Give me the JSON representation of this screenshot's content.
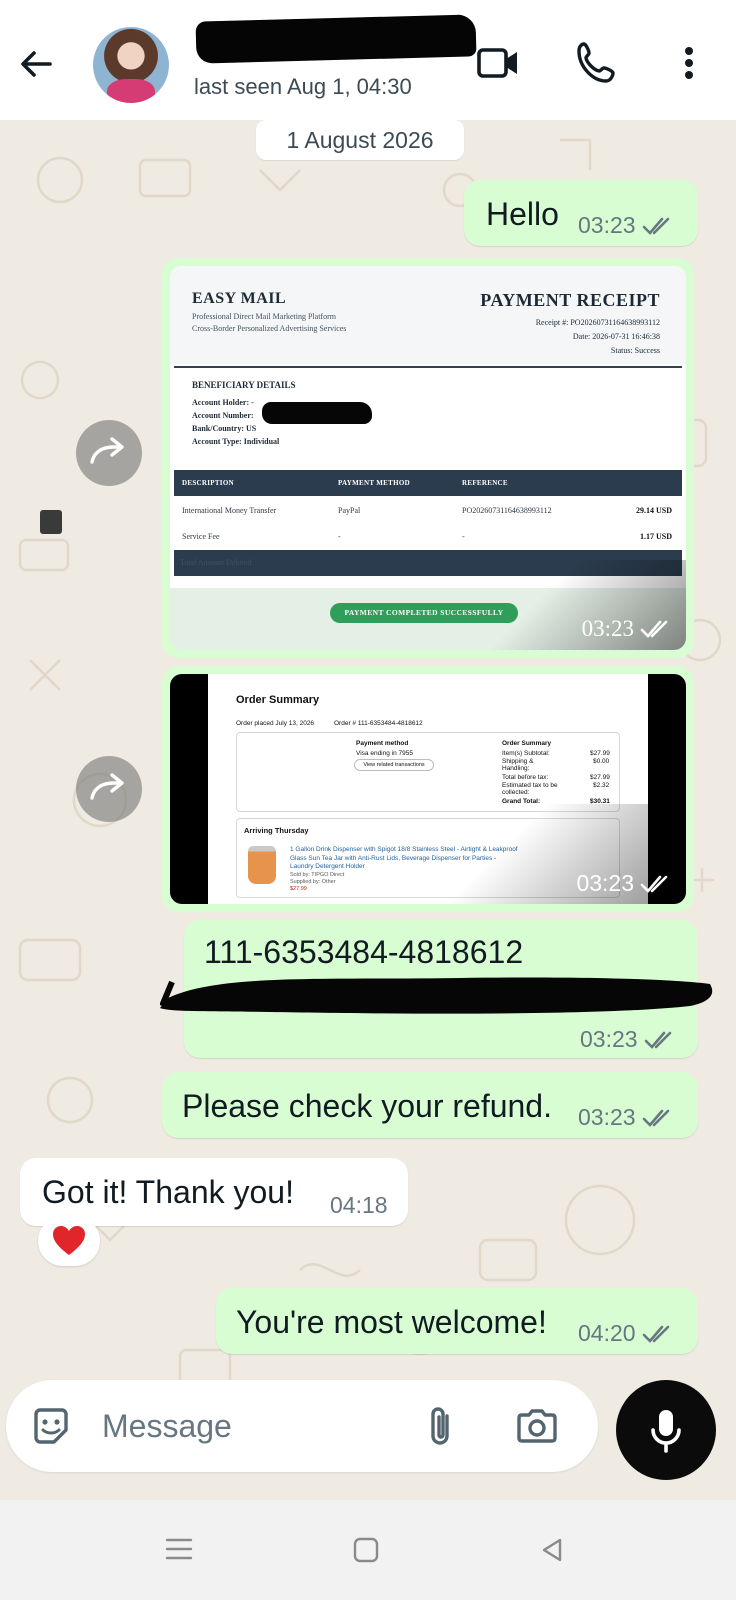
{
  "header": {
    "contact_name": "",
    "last_seen": "last seen Aug 1, 04:30",
    "video_call_icon": "video-call-icon",
    "voice_call_icon": "phone-icon",
    "menu_icon": "more-vert-icon"
  },
  "chat": {
    "date_chip": "1 August 2026",
    "messages": [
      {
        "text": "Hello",
        "time": "03:23"
      },
      {
        "time": "03:23"
      },
      {
        "time": "03:23"
      },
      {
        "text": "111-6353484-4818612",
        "time": "03:23"
      },
      {
        "text": "Please check your refund.",
        "time": "03:23"
      },
      {
        "text": "Got it! Thank you!",
        "time": "04:18",
        "reaction": "❤️"
      },
      {
        "text": "You're most welcome!",
        "time": "04:20"
      }
    ]
  },
  "receipt": {
    "brand": "EASY MAIL",
    "brand_sub1": "Professional Direct Mail Marketing Platform",
    "brand_sub2": "Cross-Border Personalized Advertising Services",
    "title": "PAYMENT RECEIPT",
    "receipt_no": "Receipt #: PO2026073116463899311​2",
    "date": "Date: 2026-07-31 16:46:38",
    "status": "Status: Success",
    "section": "BENEFICIARY DETAILS",
    "account_holder": "Account Holder: -",
    "account_number": "Account Number:",
    "bank_country": "Bank/Country: US",
    "account_type": "Account Type: Individual",
    "th_description": "DESCRIPTION",
    "th_method": "PAYMENT METHOD",
    "th_reference": "REFERENCE",
    "row1_desc": "International Money Transfer",
    "row1_method": "PayPal",
    "row1_ref": "PO2026073116463899311​2",
    "row1_amount": "29.14 USD",
    "row2_desc": "Service Fee",
    "row2_method": "-",
    "row2_ref": "-",
    "row2_amount": "1.17 USD",
    "total_label": "Total Amount Debited",
    "banner": "PAYMENT COMPLETED SUCCESSFULLY"
  },
  "order": {
    "title": "Order Summary",
    "placed": "Order placed July 13, 2026",
    "order_no": "Order # 111-6353484-4818612",
    "pm_label": "Payment method",
    "pm_value": "Visa  ending in 7955",
    "view_btn": "View related transactions",
    "os_label": "Order Summary",
    "subtotal_label": "Item(s) Subtotal:",
    "subtotal": "$27.99",
    "shipping_label": "Shipping & Handling:",
    "shipping": "$0.00",
    "before_tax_label": "Total before tax:",
    "before_tax": "$27.99",
    "tax_label": "Estimated tax to be collected:",
    "tax": "$2.32",
    "grand_label": "Grand Total:",
    "grand": "$30.31",
    "arriving": "Arriving Thursday",
    "product": "1 Gallon Drink Dispenser with Spigot 18/8 Stainless Steel - Airtight & Leakproof Glass Sun Tea Jar with Anti-Rust Lids, Beverage Dispenser for Parties - Laundry Detergent Holder",
    "sold_by": "Sold by: TIPGO Direct",
    "supplied_by": "Supplied by: Other",
    "price": "$27.99"
  },
  "input": {
    "placeholder": "Message"
  },
  "colors": {
    "outgoing_bubble": "#d9fdd3",
    "incoming_bubble": "#ffffff",
    "chat_bg": "#efeae2",
    "mic_button": "#0b0b0b"
  }
}
